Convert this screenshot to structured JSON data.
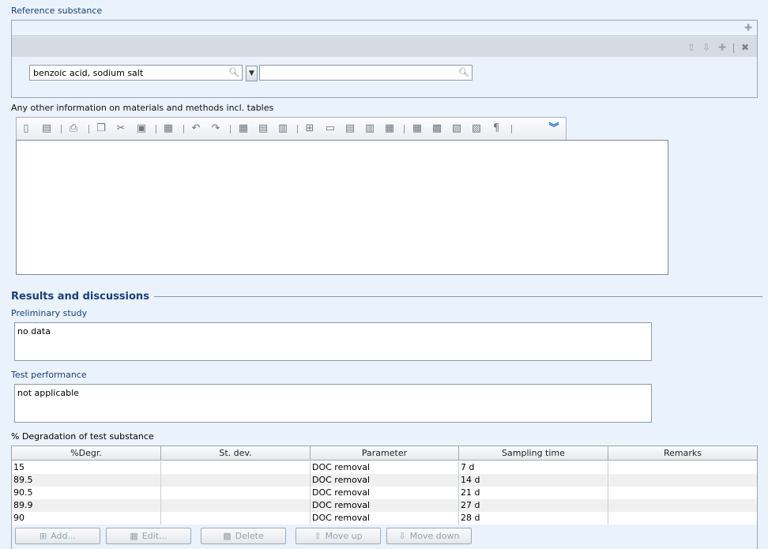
{
  "reference_substance": {
    "label": "Reference substance",
    "field1_value": "benzoic acid, sodium salt",
    "field2_value": ""
  },
  "materials_methods": {
    "label": "Any other information on materials and methods incl. tables"
  },
  "results": {
    "heading": "Results and discussions",
    "preliminary_label": "Preliminary study",
    "preliminary_value": "no data",
    "test_performance_label": "Test performance",
    "test_performance_value": "not applicable"
  },
  "degradation": {
    "label": "% Degradation of test substance",
    "columns": [
      "%Degr.",
      "St. dev.",
      "Parameter",
      "Sampling time",
      "Remarks"
    ],
    "rows": [
      [
        "15",
        "",
        "DOC removal",
        "7 d",
        ""
      ],
      [
        "89.5",
        "",
        "DOC removal",
        "14 d",
        ""
      ],
      [
        "90.5",
        "",
        "DOC removal",
        "21 d",
        ""
      ],
      [
        "89.9",
        "",
        "DOC removal",
        "27 d",
        ""
      ],
      [
        "90",
        "",
        "DOC removal",
        "28 d",
        ""
      ]
    ],
    "buttons": {
      "add": "Add...",
      "edit": "Edit...",
      "delete": "Delete",
      "move_up": "Move up",
      "move_down": "Move down"
    }
  },
  "colors": {
    "background": "#eaf2fb",
    "label_blue": "#1d3f7a",
    "row_alt": "#f0f0f0"
  }
}
